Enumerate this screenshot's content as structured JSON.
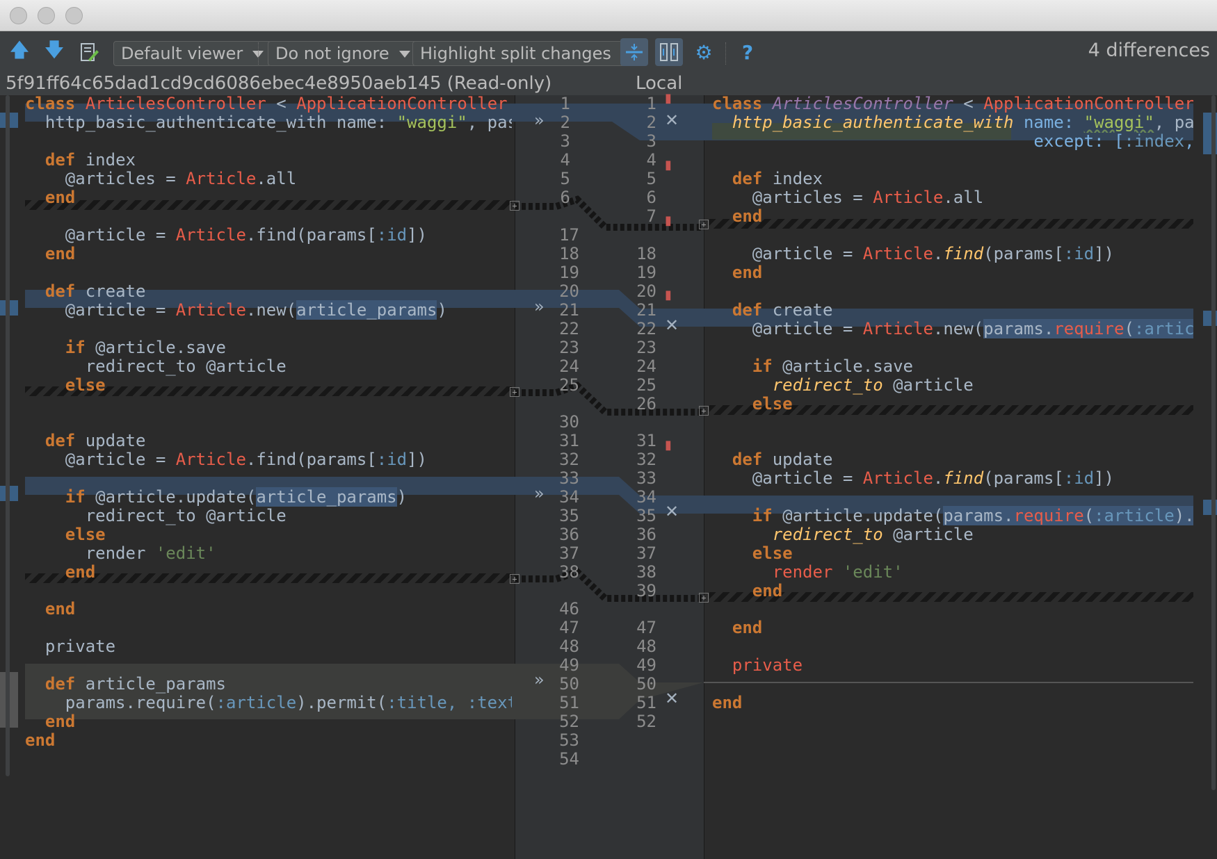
{
  "toolbar": {
    "viewer_label": "Default viewer",
    "ignore_label": "Do not ignore",
    "highlight_label": "Highlight split changes",
    "differences_count": "4 differences",
    "help_glyph": "?",
    "icons": [
      "arrow-up-icon",
      "arrow-down-icon",
      "edit-source-icon",
      "collapse-icon",
      "sync-scroll-icon",
      "gear-icon",
      "help-icon"
    ]
  },
  "left_title": "5f91ff64c65dad1cd9cd6086ebec4e8950aeb145 (Read-only)",
  "right_title": "Local",
  "left_numbers": [
    "1",
    "2",
    "3",
    "4",
    "5",
    "6",
    "17",
    "18",
    "19",
    "20",
    "21",
    "22",
    "23",
    "24",
    "25",
    "30",
    "31",
    "32",
    "33",
    "34",
    "35",
    "36",
    "37",
    "38",
    "46",
    "47",
    "48",
    "49",
    "50",
    "51",
    "52",
    "53",
    "54"
  ],
  "right_numbers": [
    "1",
    "2",
    "3",
    "4",
    "5",
    "6",
    "7",
    "18",
    "19",
    "20",
    "21",
    "22",
    "23",
    "24",
    "25",
    "26",
    "31",
    "32",
    "33",
    "34",
    "35",
    "36",
    "37",
    "38",
    "39",
    "47",
    "48",
    "49",
    "50",
    "51",
    "52"
  ],
  "colors": {
    "changed_bg": "#34455a",
    "inserted_bg": "#3f4a3f",
    "removed_bg": "#3c3d3b",
    "keyword": "#cc7832",
    "class_name": "#e85d4a"
  }
}
